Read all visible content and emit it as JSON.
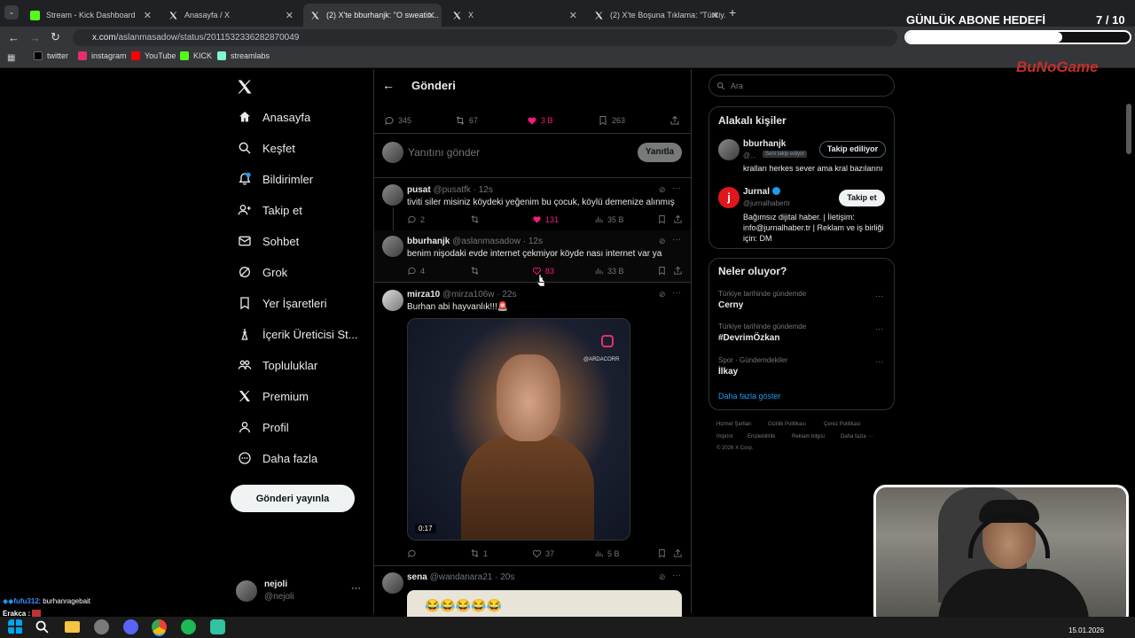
{
  "browser": {
    "tabs": [
      {
        "title": "Stream - Kick Dashboard",
        "icon": "kick-icon"
      },
      {
        "title": "Anasayfa / X",
        "icon": "x-logo-icon"
      },
      {
        "title": "(2) X'te bburhanjk: \"O sweatin...",
        "icon": "x-logo-icon",
        "active": true
      },
      {
        "title": "X",
        "icon": "x-logo-icon"
      },
      {
        "title": "(2) X'te Boşuna Tıklama: \"Türkiy...",
        "icon": "x-logo-icon"
      }
    ],
    "url_domain": "x.com",
    "url_path": "/aslanmasadow/status/2011532336282870049",
    "bookmarks": [
      {
        "label": "twitter",
        "color": "#000000"
      },
      {
        "label": "instagram",
        "color": "#e1306c"
      },
      {
        "label": "YouTube",
        "color": "#ff0000"
      },
      {
        "label": "KICK",
        "color": "#53fc18"
      },
      {
        "label": "streamlabs",
        "color": "#80f5d2"
      }
    ]
  },
  "overlay": {
    "goal_title": "GÜNLÜK ABONE HEDEFİ",
    "goal_count": "7",
    "goal_total": "/ 10",
    "goal_progress": 0.7,
    "brand": "BuNoGame",
    "chat_user": "fufu312",
    "chat_msg": ": burhanragebait",
    "chat_user2": "Erakca :",
    "date": "15.01.2026"
  },
  "sidebar": {
    "items": [
      {
        "label": "Anasayfa",
        "icon": "home-icon"
      },
      {
        "label": "Keşfet",
        "icon": "search-icon"
      },
      {
        "label": "Bildirimler",
        "icon": "bell-icon"
      },
      {
        "label": "Takip et",
        "icon": "follow-icon"
      },
      {
        "label": "Sohbet",
        "icon": "mail-icon"
      },
      {
        "label": "Grok",
        "icon": "grok-icon"
      },
      {
        "label": "Yer İşaretleri",
        "icon": "bookmark-icon"
      },
      {
        "label": "İçerik Üreticisi St...",
        "icon": "creator-icon"
      },
      {
        "label": "Topluluklar",
        "icon": "communities-icon"
      },
      {
        "label": "Premium",
        "icon": "x-logo-icon"
      },
      {
        "label": "Profil",
        "icon": "profile-icon"
      },
      {
        "label": "Daha fazla",
        "icon": "more-circle-icon"
      }
    ],
    "post_button": "Gönderi yayınla",
    "account_name": "nejoli",
    "account_handle": "@nejoli"
  },
  "main": {
    "header_title": "Gönderi",
    "main_stats": {
      "replies": "345",
      "reposts": "67",
      "likes": "3 B",
      "bookmarks": "263"
    },
    "reply_placeholder": "Yanıtını gönder",
    "reply_button": "Yanıtla",
    "replies": [
      {
        "name": "pusat",
        "handle": "@pusatfk",
        "time": "· 12s",
        "text": "tiviti siler misiniz köydeki yeğenim bu çocuk, köylü demenize alınmış",
        "replies": "2",
        "reposts": "",
        "likes": "131",
        "views": "35 B"
      },
      {
        "name": "bburhanjk",
        "handle": "@aslanmasadow",
        "time": "· 12s",
        "text": "benim nişodaki evde internet çekmiyor köyde nası internet var ya",
        "replies": "4",
        "reposts": "",
        "likes": "83",
        "views": "33 B"
      },
      {
        "name": "mirza10",
        "handle": "@mirza106w",
        "time": "· 22s",
        "text": "Burhan abi hayvanlık!!!🚨",
        "media_watermark": "@ARDACORR",
        "media_duration": "0:17",
        "replies": "",
        "reposts": "1",
        "likes": "37",
        "views": "5 B"
      },
      {
        "name": "sena",
        "handle": "@wandanara21",
        "time": "· 20s",
        "text": "😂😂😂😂😂"
      }
    ]
  },
  "right": {
    "search_placeholder": "Ara",
    "people_title": "Alakalı kişiler",
    "people": [
      {
        "name": "bburhanjk",
        "handle": "@...",
        "badge": "Seni takip ediyor",
        "bio": "kralları herkes sever ama kral bazılarını",
        "button": "Takip ediliyor"
      },
      {
        "name": "Jurnal",
        "handle": "@jurnalhabertr",
        "bio": "Bağımsız dijital haber. | İletişim: info@jurnalhaber.tr | Reklam ve iş birliği için: DM",
        "button": "Takip et"
      }
    ],
    "trends_title": "Neler oluyor?",
    "trends": [
      {
        "context": "Türkiye tarihinde gündemde",
        "name": "Cerny"
      },
      {
        "context": "Türkiye tarihinde gündemde",
        "name": "#DevrimÖzkan"
      },
      {
        "context": "Spor · Gündemdekiler",
        "name": "İlkay"
      }
    ],
    "show_more": "Daha fazla göster",
    "footer": [
      "Hizmet Şartları",
      "Gizlilik Politikası",
      "Çerez Politikası",
      "Imprint",
      "Erişilebilirlik",
      "Reklam bilgisi",
      "Daha fazla ···",
      "© 2026 X Corp."
    ]
  }
}
